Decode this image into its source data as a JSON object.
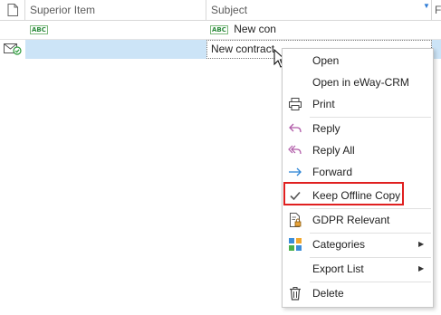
{
  "grid": {
    "columns": [
      "",
      "Superior Item",
      "Subject",
      "F"
    ],
    "rows": [
      {
        "superior": "",
        "subject": "New con"
      },
      {
        "superior": "",
        "subject": "New contract"
      }
    ]
  },
  "context_menu": {
    "items": [
      {
        "label": "Open",
        "icon": "none"
      },
      {
        "label": "Open in eWay-CRM",
        "icon": "none"
      },
      {
        "label": "Print",
        "icon": "printer-icon"
      },
      {
        "label": "Reply",
        "icon": "reply-icon"
      },
      {
        "label": "Reply All",
        "icon": "reply-all-icon"
      },
      {
        "label": "Forward",
        "icon": "forward-icon"
      },
      {
        "label": "Keep Offline Copy",
        "icon": "checkmark-icon",
        "checked": true
      },
      {
        "label": "GDPR Relevant",
        "icon": "gdpr-lock-icon"
      },
      {
        "label": "Categories",
        "icon": "categories-icon",
        "submenu": true
      },
      {
        "label": "Export List",
        "icon": "none",
        "submenu": true
      },
      {
        "label": "Delete",
        "icon": "trash-icon"
      }
    ]
  },
  "colors": {
    "selection": "#cce4f7",
    "highlight_border": "#e02020",
    "reply_purple": "#b05aa8",
    "forward_blue": "#2f86d6"
  }
}
